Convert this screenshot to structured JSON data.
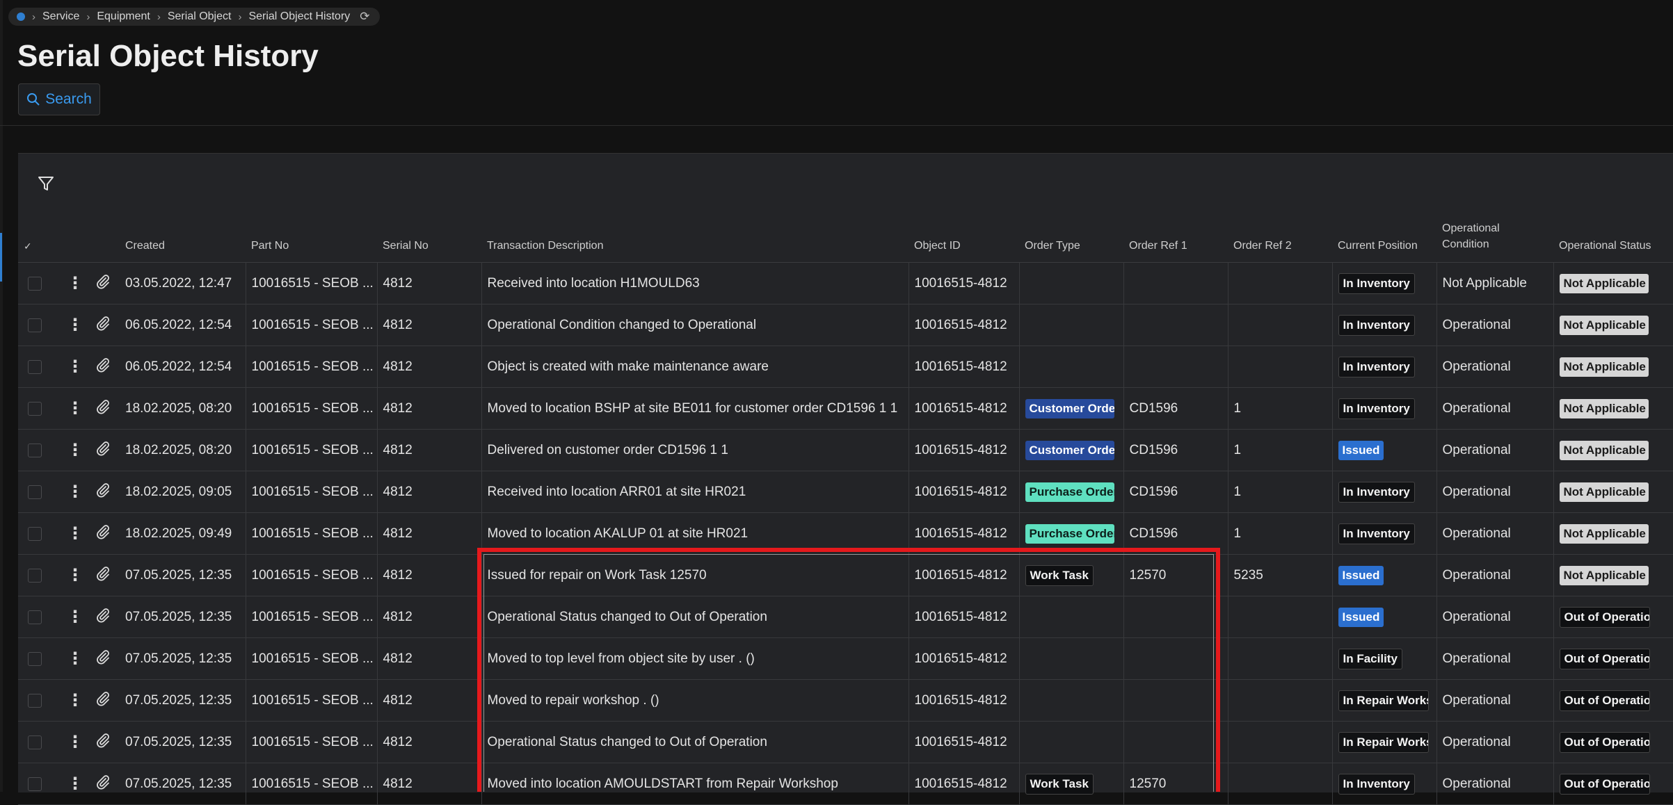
{
  "breadcrumb": {
    "items": [
      "Service",
      "Equipment",
      "Serial Object",
      "Serial Object History"
    ]
  },
  "page": {
    "title": "Serial Object History"
  },
  "toolbar": {
    "search_label": "Search"
  },
  "table": {
    "headers": {
      "select": "✓",
      "created": "Created",
      "part_no": "Part No",
      "serial_no": "Serial No",
      "transaction_description": "Transaction Description",
      "object_id": "Object ID",
      "order_type": "Order Type",
      "order_ref_1": "Order Ref 1",
      "order_ref_2": "Order Ref 2",
      "current_position": "Current Position",
      "operational_condition": "Operational Condition",
      "operational_status": "Operational Status"
    },
    "rows": [
      {
        "created": "03.05.2022, 12:47",
        "part_no": "10016515 - SEOB ...",
        "serial_no": "4812",
        "description": "Received into location H1MOULD63",
        "object_id": "10016515-4812",
        "order_type": "",
        "order_ref_1": "",
        "order_ref_2": "",
        "current_position": "In Inventory",
        "operational_condition": "Not Applicable",
        "operational_status": "Not Applicable"
      },
      {
        "created": "06.05.2022, 12:54",
        "part_no": "10016515 - SEOB ...",
        "serial_no": "4812",
        "description": "Operational Condition changed to Operational",
        "object_id": "10016515-4812",
        "order_type": "",
        "order_ref_1": "",
        "order_ref_2": "",
        "current_position": "In Inventory",
        "operational_condition": "Operational",
        "operational_status": "Not Applicable"
      },
      {
        "created": "06.05.2022, 12:54",
        "part_no": "10016515 - SEOB ...",
        "serial_no": "4812",
        "description": "Object is created with make maintenance aware",
        "object_id": "10016515-4812",
        "order_type": "",
        "order_ref_1": "",
        "order_ref_2": "",
        "current_position": "In Inventory",
        "operational_condition": "Operational",
        "operational_status": "Not Applicable"
      },
      {
        "created": "18.02.2025, 08:20",
        "part_no": "10016515 - SEOB ...",
        "serial_no": "4812",
        "description": "Moved to location BSHP at site BE011 for customer order CD1596 1 1",
        "object_id": "10016515-4812",
        "order_type": "Customer Order",
        "order_ref_1": "CD1596",
        "order_ref_2": "1",
        "current_position": "In Inventory",
        "operational_condition": "Operational",
        "operational_status": "Not Applicable"
      },
      {
        "created": "18.02.2025, 08:20",
        "part_no": "10016515 - SEOB ...",
        "serial_no": "4812",
        "description": "Delivered on customer order CD1596 1 1",
        "object_id": "10016515-4812",
        "order_type": "Customer Order",
        "order_ref_1": "CD1596",
        "order_ref_2": "1",
        "current_position": "Issued",
        "operational_condition": "Operational",
        "operational_status": "Not Applicable"
      },
      {
        "created": "18.02.2025, 09:05",
        "part_no": "10016515 - SEOB ...",
        "serial_no": "4812",
        "description": "Received into location ARR01 at site HR021",
        "object_id": "10016515-4812",
        "order_type": "Purchase Order",
        "order_ref_1": "CD1596",
        "order_ref_2": "1",
        "current_position": "In Inventory",
        "operational_condition": "Operational",
        "operational_status": "Not Applicable"
      },
      {
        "created": "18.02.2025, 09:49",
        "part_no": "10016515 - SEOB ...",
        "serial_no": "4812",
        "description": "Moved to location AKALUP 01 at site HR021",
        "object_id": "10016515-4812",
        "order_type": "Purchase Order",
        "order_ref_1": "CD1596",
        "order_ref_2": "1",
        "current_position": "In Inventory",
        "operational_condition": "Operational",
        "operational_status": "Not Applicable"
      },
      {
        "created": "07.05.2025, 12:35",
        "part_no": "10016515 - SEOB ...",
        "serial_no": "4812",
        "description": "Issued for repair on Work Task 12570",
        "object_id": "10016515-4812",
        "order_type": "Work Task",
        "order_ref_1": "12570",
        "order_ref_2": "5235",
        "current_position": "Issued",
        "operational_condition": "Operational",
        "operational_status": "Not Applicable"
      },
      {
        "created": "07.05.2025, 12:35",
        "part_no": "10016515 - SEOB ...",
        "serial_no": "4812",
        "description": "Operational Status changed to Out of Operation",
        "object_id": "10016515-4812",
        "order_type": "",
        "order_ref_1": "",
        "order_ref_2": "",
        "current_position": "Issued",
        "operational_condition": "Operational",
        "operational_status": "Out of Operation"
      },
      {
        "created": "07.05.2025, 12:35",
        "part_no": "10016515 - SEOB ...",
        "serial_no": "4812",
        "description": "Moved to top level from object  site   by user . ()",
        "object_id": "10016515-4812",
        "order_type": "",
        "order_ref_1": "",
        "order_ref_2": "",
        "current_position": "In Facility",
        "operational_condition": "Operational",
        "operational_status": "Out of Operation"
      },
      {
        "created": "07.05.2025, 12:35",
        "part_no": "10016515 - SEOB ...",
        "serial_no": "4812",
        "description": "Moved to repair workshop . ()",
        "object_id": "10016515-4812",
        "order_type": "",
        "order_ref_1": "",
        "order_ref_2": "",
        "current_position": "In Repair Workshop",
        "operational_condition": "Operational",
        "operational_status": "Out of Operation"
      },
      {
        "created": "07.05.2025, 12:35",
        "part_no": "10016515 - SEOB ...",
        "serial_no": "4812",
        "description": "Operational Status changed to Out of Operation",
        "object_id": "10016515-4812",
        "order_type": "",
        "order_ref_1": "",
        "order_ref_2": "",
        "current_position": "In Repair Workshop",
        "operational_condition": "Operational",
        "operational_status": "Out of Operation"
      },
      {
        "created": "07.05.2025, 12:35",
        "part_no": "10016515 - SEOB ...",
        "serial_no": "4812",
        "description": "Moved into location AMOULDSTART from Repair Workshop",
        "object_id": "10016515-4812",
        "order_type": "Work Task",
        "order_ref_1": "12570",
        "order_ref_2": "",
        "current_position": "In Inventory",
        "operational_condition": "Operational",
        "operational_status": "Out of Operation"
      }
    ]
  },
  "colors": {
    "accent": "#3a9bf0",
    "highlight": "#e5191c",
    "issued_badge": "#2b6fcf",
    "not_applicable_badge": "#d6d6d6",
    "customer_order_badge": "#274a9b",
    "purchase_order_badge": "#5fe0c0"
  },
  "icons": [
    "circle-dot-icon",
    "chevron-right-icon",
    "refresh-icon",
    "search-icon",
    "filter-icon",
    "kebab-menu-icon",
    "paperclip-icon",
    "checkbox-icon"
  ]
}
